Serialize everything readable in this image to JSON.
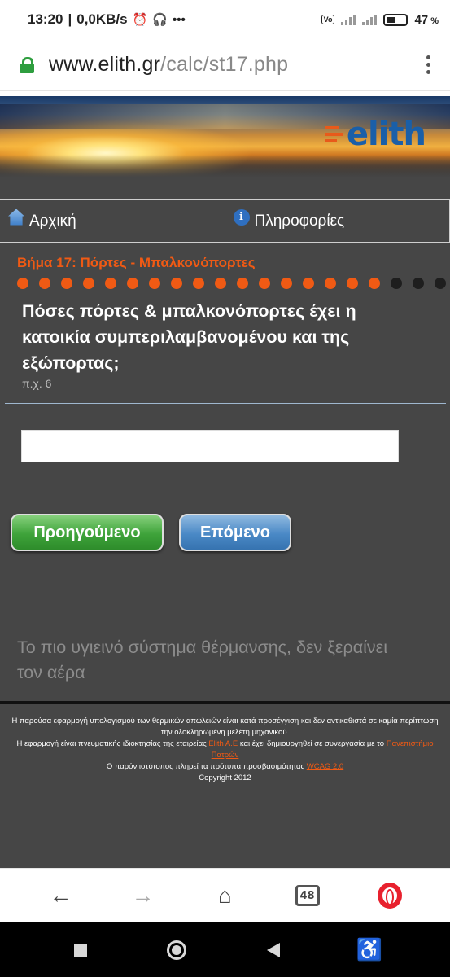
{
  "status_bar": {
    "time": "13:20",
    "speed": "0,0KB/s",
    "battery": "47"
  },
  "browser": {
    "url_domain": "www.elith.gr",
    "url_path": "/calc/st17.php",
    "tabs_count": "48"
  },
  "site": {
    "logo": "elith",
    "nav": {
      "home": "Αρχική",
      "info": "Πληροφορίες"
    }
  },
  "step": {
    "title": "Βήμα 17: Πόρτες - Μπαλκονόπορτες",
    "total_steps": 20,
    "current_step": 17,
    "question": "Πόσες πόρτες & μπαλκονόπορτες έχει η κατοικία συμπεριλαμβανομένου και της εξώπορτας;",
    "hint": "π.χ. 6",
    "answer_value": ""
  },
  "buttons": {
    "previous": "Προηγούμενο",
    "next": "Επόμενο"
  },
  "tagline": "Το πιο υγιεινό σύστημα θέρμανσης, δεν ξεραίνει τον αέρα",
  "footer": {
    "line1": "Η παρούσα εφαρμογή υπολογισμού των θερμικών απωλειών είναι κατά προσέγγιση και δεν αντικαθιστά σε καμία περίπτωση την ολοκληρωμένη μελέτη μηχανικού.",
    "line2_before": "Η εφαρμογή είναι πνευματικής ιδιοκτησίας της εταιρείας ",
    "line2_link1": "Elith A.E",
    "line2_middle": " και έχει δημιουργηθεί σε συνεργασία με το ",
    "line2_link2": "Πανεπιστήμιο Πατρών",
    "line3_before": "Ο παρόν ιστότοπος πληρεί τα πρότυπα προσβασιμότητας ",
    "line3_link": "WCAG 2.0",
    "copyright": "Copyright 2012"
  },
  "colors": {
    "accent_orange": "#f05a14",
    "dot_done": "#f05a14",
    "dot_pending": "#1e1e1e",
    "background": "#464646"
  }
}
